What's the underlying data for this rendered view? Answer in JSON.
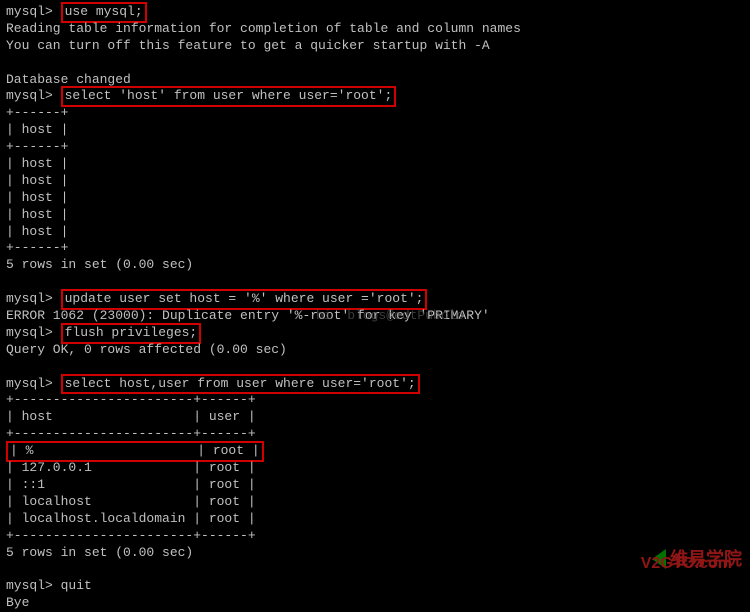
{
  "lines": {
    "l1_prompt": "mysql> ",
    "l1_cmd": "use mysql;",
    "l2": "Reading table information for completion of table and column names",
    "l3": "You can turn off this feature to get a quicker startup with -A",
    "l4": " ",
    "l5": "Database changed",
    "l6_prompt": "mysql> ",
    "l6_cmd": "select 'host' from user where user='root';",
    "l7": "+------+",
    "l8": "| host |",
    "l9": "+------+",
    "l10": "| host |",
    "l11": "| host |",
    "l12": "| host |",
    "l13": "| host |",
    "l14": "| host |",
    "l15": "+------+",
    "l16": "5 rows in set (0.00 sec)",
    "l17": " ",
    "l18_prompt": "mysql> ",
    "l18_cmd": "update user set host = '%' where user ='root';",
    "l19": "ERROR 1062 (23000): Duplicate entry '%-root' for key 'PRIMARY'",
    "l20_prompt": "mysql> ",
    "l20_cmd": "flush privileges;",
    "l21": "Query OK, 0 rows affected (0.00 sec)",
    "l22": " ",
    "l23_prompt": "mysql> ",
    "l23_cmd": "select host,user from user where user='root';",
    "l24": "+-----------------------+------+",
    "l25": "| host                  | user |",
    "l26": "+-----------------------+------+",
    "l27": "| %                     | root |",
    "l28": "| 127.0.0.1             | root |",
    "l29": "| ::1                   | root |",
    "l30": "| localhost             | root |",
    "l31": "| localhost.localdomain | root |",
    "l32": "+-----------------------+------+",
    "l33": "5 rows in set (0.00 sec)",
    "l34": " ",
    "l35": "mysql> quit",
    "l36": "Bye"
  },
  "ghost": "hi  blogs@edtPubolo",
  "watermark": {
    "text1": "维易学院",
    "text2": "V2GTO.com"
  }
}
